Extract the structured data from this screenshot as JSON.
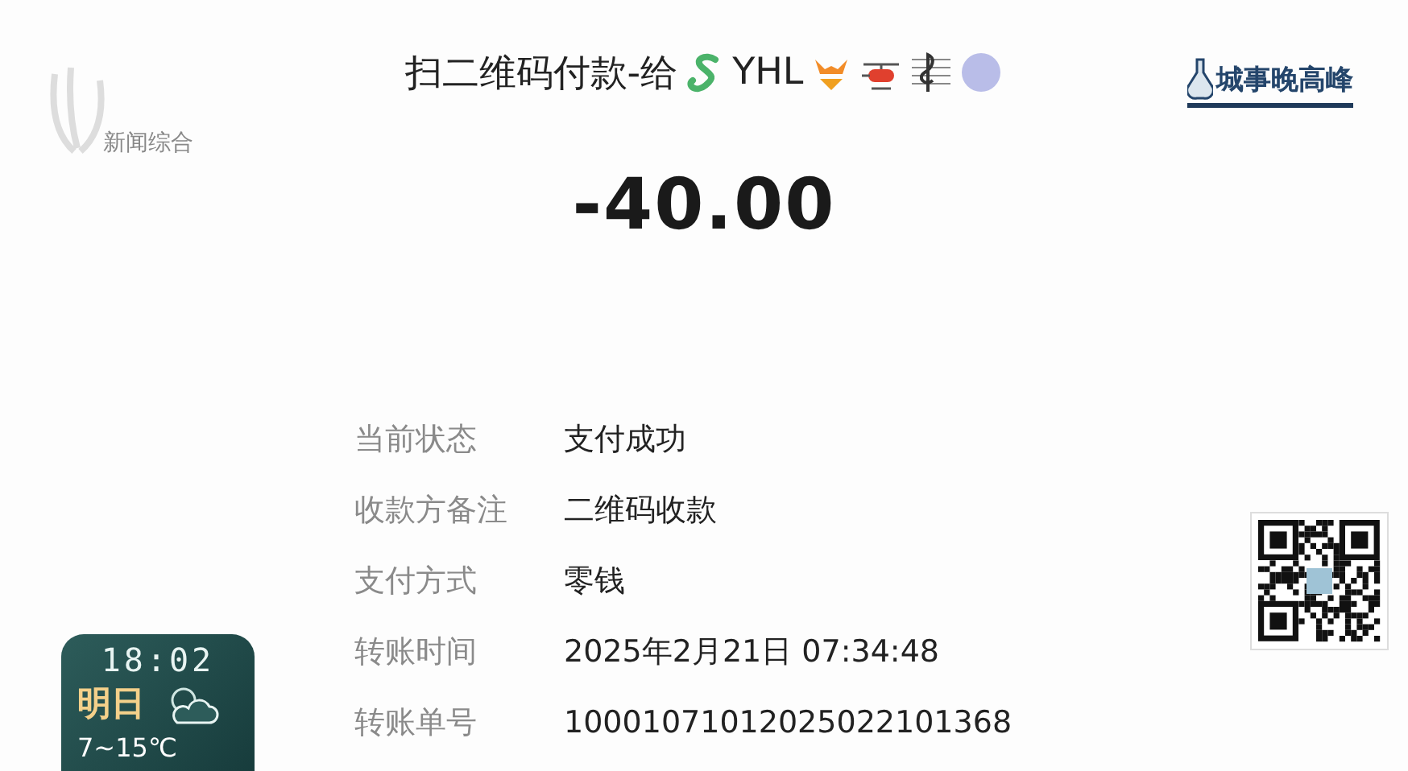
{
  "broadcast": {
    "channel_logo": "新闻综合",
    "program_logo": "城事晚高峰",
    "clock": "18:02",
    "weather": {
      "day": "明日",
      "temperature": "7~15℃"
    }
  },
  "payment": {
    "title": "扫二维码付款-给",
    "payee": "YHL",
    "amount": "-40.00",
    "details": [
      {
        "label": "当前状态",
        "value": "支付成功"
      },
      {
        "label": "收款方备注",
        "value": "二维码收款"
      },
      {
        "label": "支付方式",
        "value": "零钱"
      },
      {
        "label": "转账时间",
        "value": "2025年2月21日 07:34:48"
      },
      {
        "label": "转账单号",
        "value": "10001071012025022101368"
      }
    ]
  }
}
